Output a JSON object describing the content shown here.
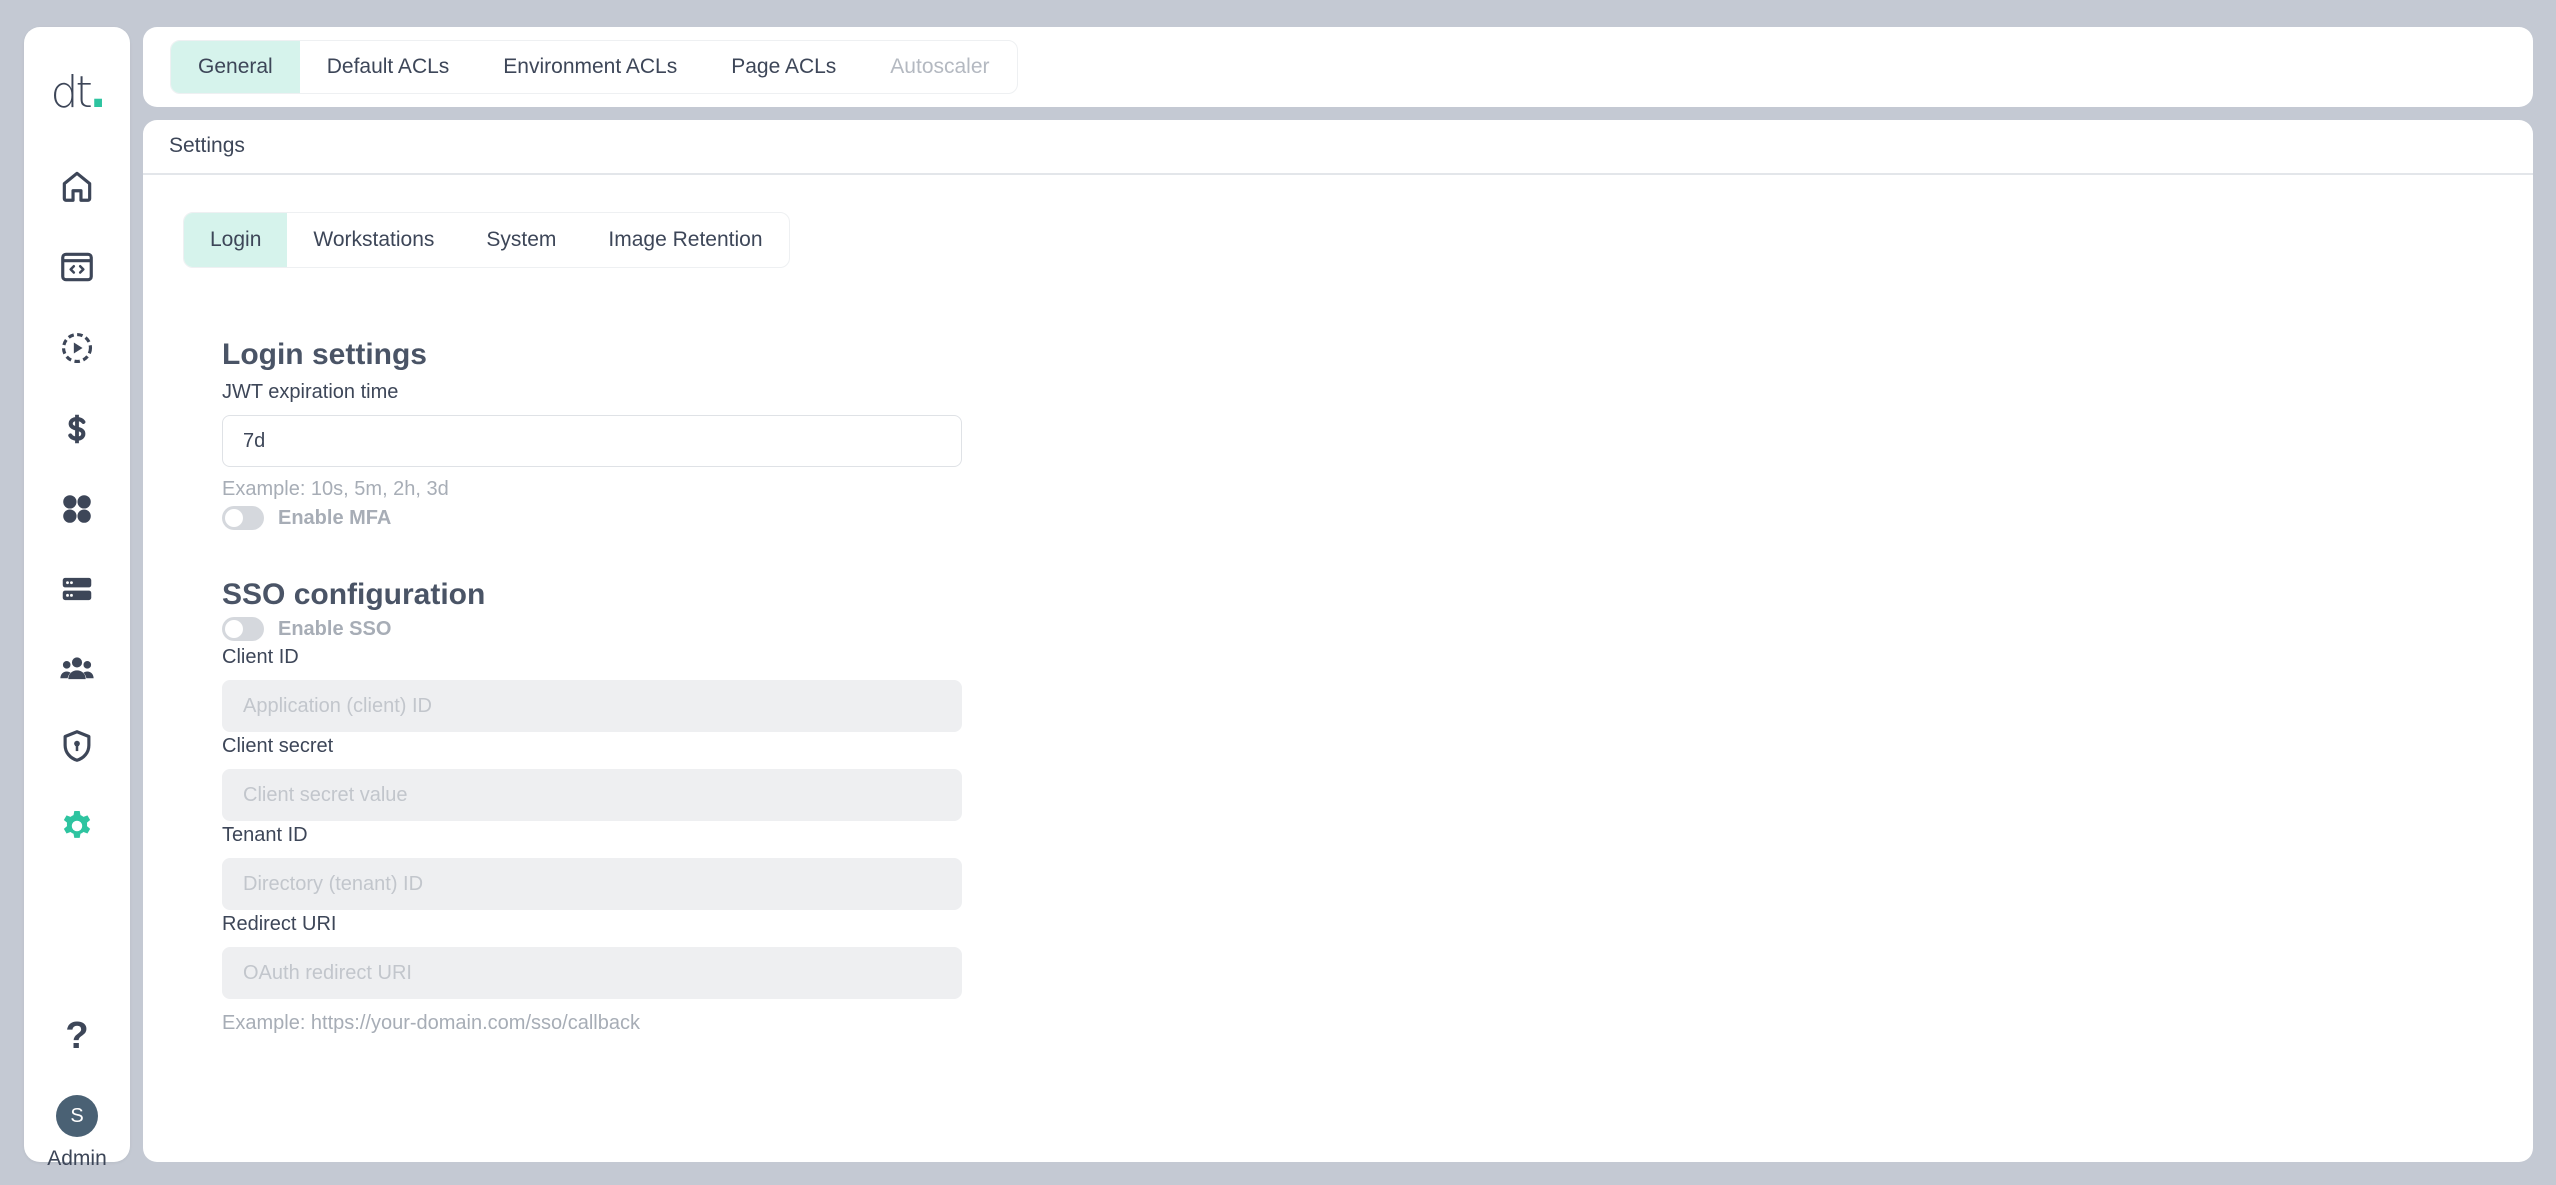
{
  "app": {
    "logo_text": "dt",
    "logo_dot": "."
  },
  "sidebar": {
    "items": [
      {
        "name": "home-icon"
      },
      {
        "name": "code-window-icon"
      },
      {
        "name": "play-circle-icon"
      },
      {
        "name": "dollar-icon"
      },
      {
        "name": "grid-icon"
      },
      {
        "name": "server-icon"
      },
      {
        "name": "users-icon"
      },
      {
        "name": "shield-icon"
      },
      {
        "name": "gear-icon",
        "active": true
      }
    ],
    "help_label": "?",
    "avatar_initial": "S",
    "user_label": "Admin",
    "accent_color": "#2ec4a0"
  },
  "top_tabs": [
    {
      "label": "General",
      "active": true
    },
    {
      "label": "Default ACLs"
    },
    {
      "label": "Environment ACLs"
    },
    {
      "label": "Page ACLs"
    },
    {
      "label": "Autoscaler",
      "disabled": true
    }
  ],
  "breadcrumb": "Settings",
  "sub_tabs": [
    {
      "label": "Login",
      "active": true
    },
    {
      "label": "Workstations"
    },
    {
      "label": "System"
    },
    {
      "label": "Image Retention"
    }
  ],
  "login": {
    "title": "Login settings",
    "jwt_label": "JWT expiration time",
    "jwt_value": "7d",
    "jwt_hint": "Example: 10s, 5m, 2h, 3d",
    "mfa_label": "Enable MFA",
    "mfa_enabled": false
  },
  "sso": {
    "title": "SSO configuration",
    "enable_label": "Enable SSO",
    "enabled": false,
    "client_id_label": "Client ID",
    "client_id_placeholder": "Application (client) ID",
    "client_secret_label": "Client secret",
    "client_secret_placeholder": "Client secret value",
    "tenant_id_label": "Tenant ID",
    "tenant_id_placeholder": "Directory (tenant) ID",
    "redirect_uri_label": "Redirect URI",
    "redirect_uri_placeholder": "OAuth redirect URI",
    "redirect_uri_hint": "Example: https://your-domain.com/sso/callback"
  }
}
